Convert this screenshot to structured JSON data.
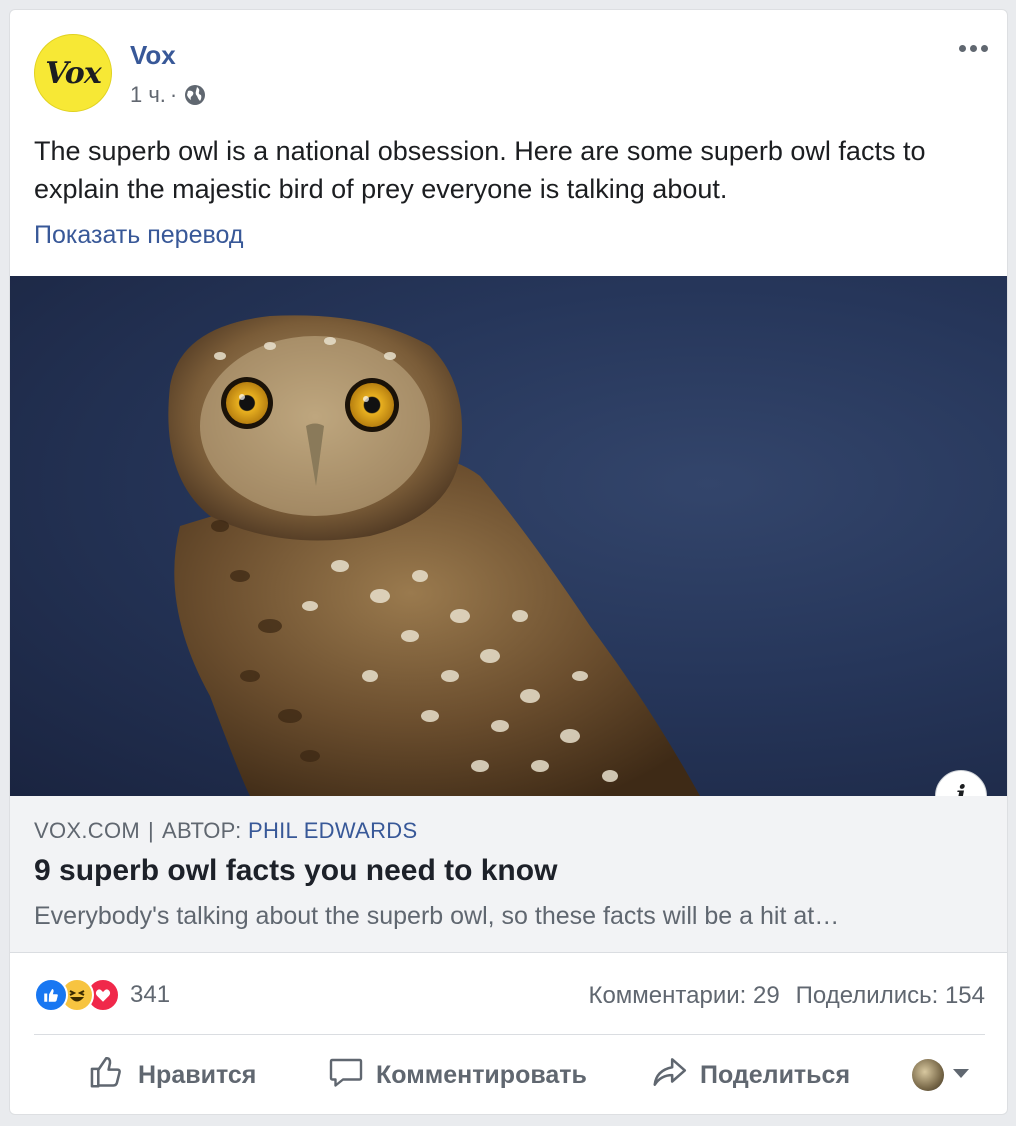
{
  "post": {
    "page_name": "Vox",
    "avatar_text": "Vox",
    "time": "1 ч.",
    "dot": "·",
    "text": "The superb owl is a national obsession. Here are some superb owl facts to explain the majestic bird of prey everyone is talking about.",
    "translate_label": "Показать перевод"
  },
  "link": {
    "source": "VOX.COM",
    "separator": "|",
    "author_prefix": "АВТОР:",
    "author": "PHIL EDWARDS",
    "title": "9 superb owl facts you need to know",
    "description": "Everybody's talking about the superb owl, so these facts will be a hit at…",
    "info_label": "i"
  },
  "stats": {
    "reaction_count": "341",
    "comments": "Комментарии: 29",
    "shares": "Поделились: 154"
  },
  "actions": {
    "like": "Нравится",
    "comment": "Комментировать",
    "share": "Поделиться"
  },
  "icons": {
    "globe": "globe-icon",
    "more": "more-icon",
    "like": "thumbs-up-icon",
    "comment": "comment-icon",
    "share": "share-icon",
    "caret": "caret-down-icon"
  },
  "colors": {
    "link_blue": "#385898",
    "like_blue": "#1877f2",
    "love_red": "#f0284a",
    "haha_yellow": "#f7c440",
    "vox_yellow": "#f7e835"
  }
}
